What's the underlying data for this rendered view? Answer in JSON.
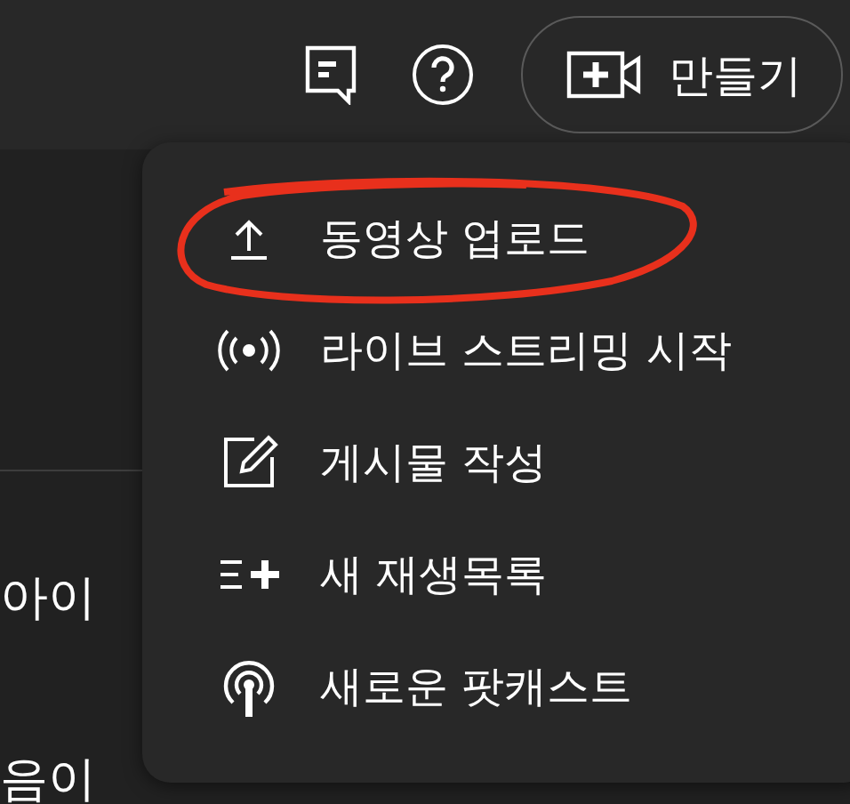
{
  "header": {
    "create_button": {
      "label": "만들기"
    }
  },
  "background_texts": [
    "아이",
    "음이"
  ],
  "menu": {
    "items": [
      {
        "kind": "upload",
        "label": "동영상 업로드",
        "highlighted": true
      },
      {
        "kind": "live",
        "label": "라이브 스트리밍 시작",
        "highlighted": false
      },
      {
        "kind": "post",
        "label": "게시물 작성",
        "highlighted": false
      },
      {
        "kind": "playlist",
        "label": "새 재생목록",
        "highlighted": false
      },
      {
        "kind": "podcast",
        "label": "새로운 팟캐스트",
        "highlighted": false
      }
    ]
  }
}
